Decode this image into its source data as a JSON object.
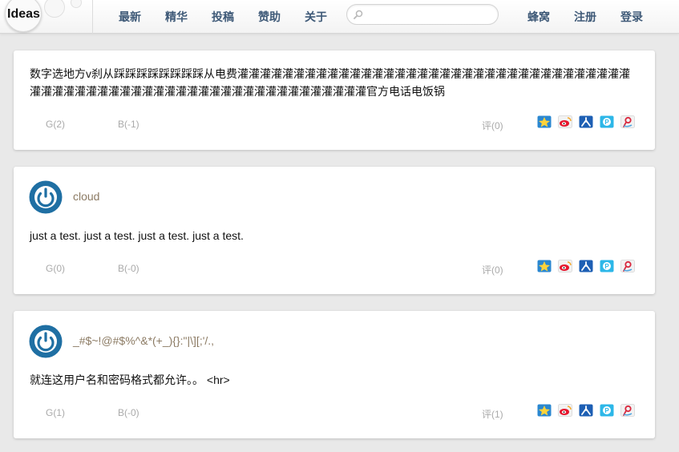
{
  "header": {
    "logo": "Ideas",
    "nav": [
      "最新",
      "精华",
      "投稿",
      "赞助",
      "关于"
    ],
    "search_placeholder": "",
    "right_links": [
      "蜂窝",
      "注册",
      "登录"
    ]
  },
  "posts": [
    {
      "author": "",
      "content": "数字选地方v刹从踩踩踩踩踩踩踩踩从电费灌灌灌灌灌灌灌灌灌灌灌灌灌灌灌灌灌灌灌灌灌灌灌灌灌灌灌灌灌灌灌灌灌灌灌灌灌灌灌灌灌灌灌灌灌灌灌灌灌灌灌灌灌灌灌灌灌灌灌灌灌灌灌灌灌官方电话电饭锅",
      "good": "G(2)",
      "bad": "B(-1)",
      "comments": "评(0)"
    },
    {
      "author": "cloud",
      "content": "just a test. just a test. just a test. just a test.",
      "good": "G(0)",
      "bad": "B(-0)",
      "comments": "评(0)"
    },
    {
      "author": "_#$~!@#$%^&*(+_){}:\"|\\][;'/.,",
      "content": "就连这用户名和密码格式都允许。。 <hr>",
      "good": "G(1)",
      "bad": "B(-0)",
      "comments": "评(1)"
    }
  ],
  "share_icons": [
    "qzone-icon",
    "weibo-icon",
    "renren-icon",
    "pengyou-icon",
    "tencent-weibo-icon"
  ],
  "colors": {
    "nav": "#3f5a78",
    "author": "#8c7b64",
    "meta": "#aaaaaa",
    "avatar": "#1f6fa3"
  }
}
